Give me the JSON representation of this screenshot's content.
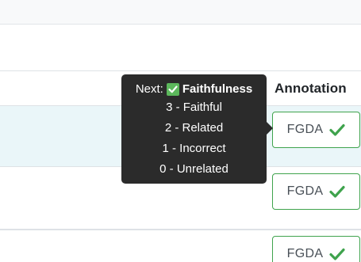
{
  "table": {
    "annotation_header": "Annotation",
    "rows": [
      {
        "annotation_label": "FGDA"
      },
      {
        "annotation_label": "FGDA"
      },
      {
        "annotation_label": "FGDA"
      }
    ]
  },
  "tooltip": {
    "next_label": "Next:",
    "metric": "Faithfulness",
    "options": [
      "3 - Faithful",
      "2 - Related",
      "1 - Incorrect",
      "0 - Unrelated"
    ]
  },
  "icons": {
    "row_check": "checkmark-icon",
    "tooltip_check": "check-box-icon"
  },
  "colors": {
    "accent_green": "#3fa34d",
    "tooltip_bg": "#2b2b2b",
    "selected_row_bg": "#eaf6f9"
  }
}
